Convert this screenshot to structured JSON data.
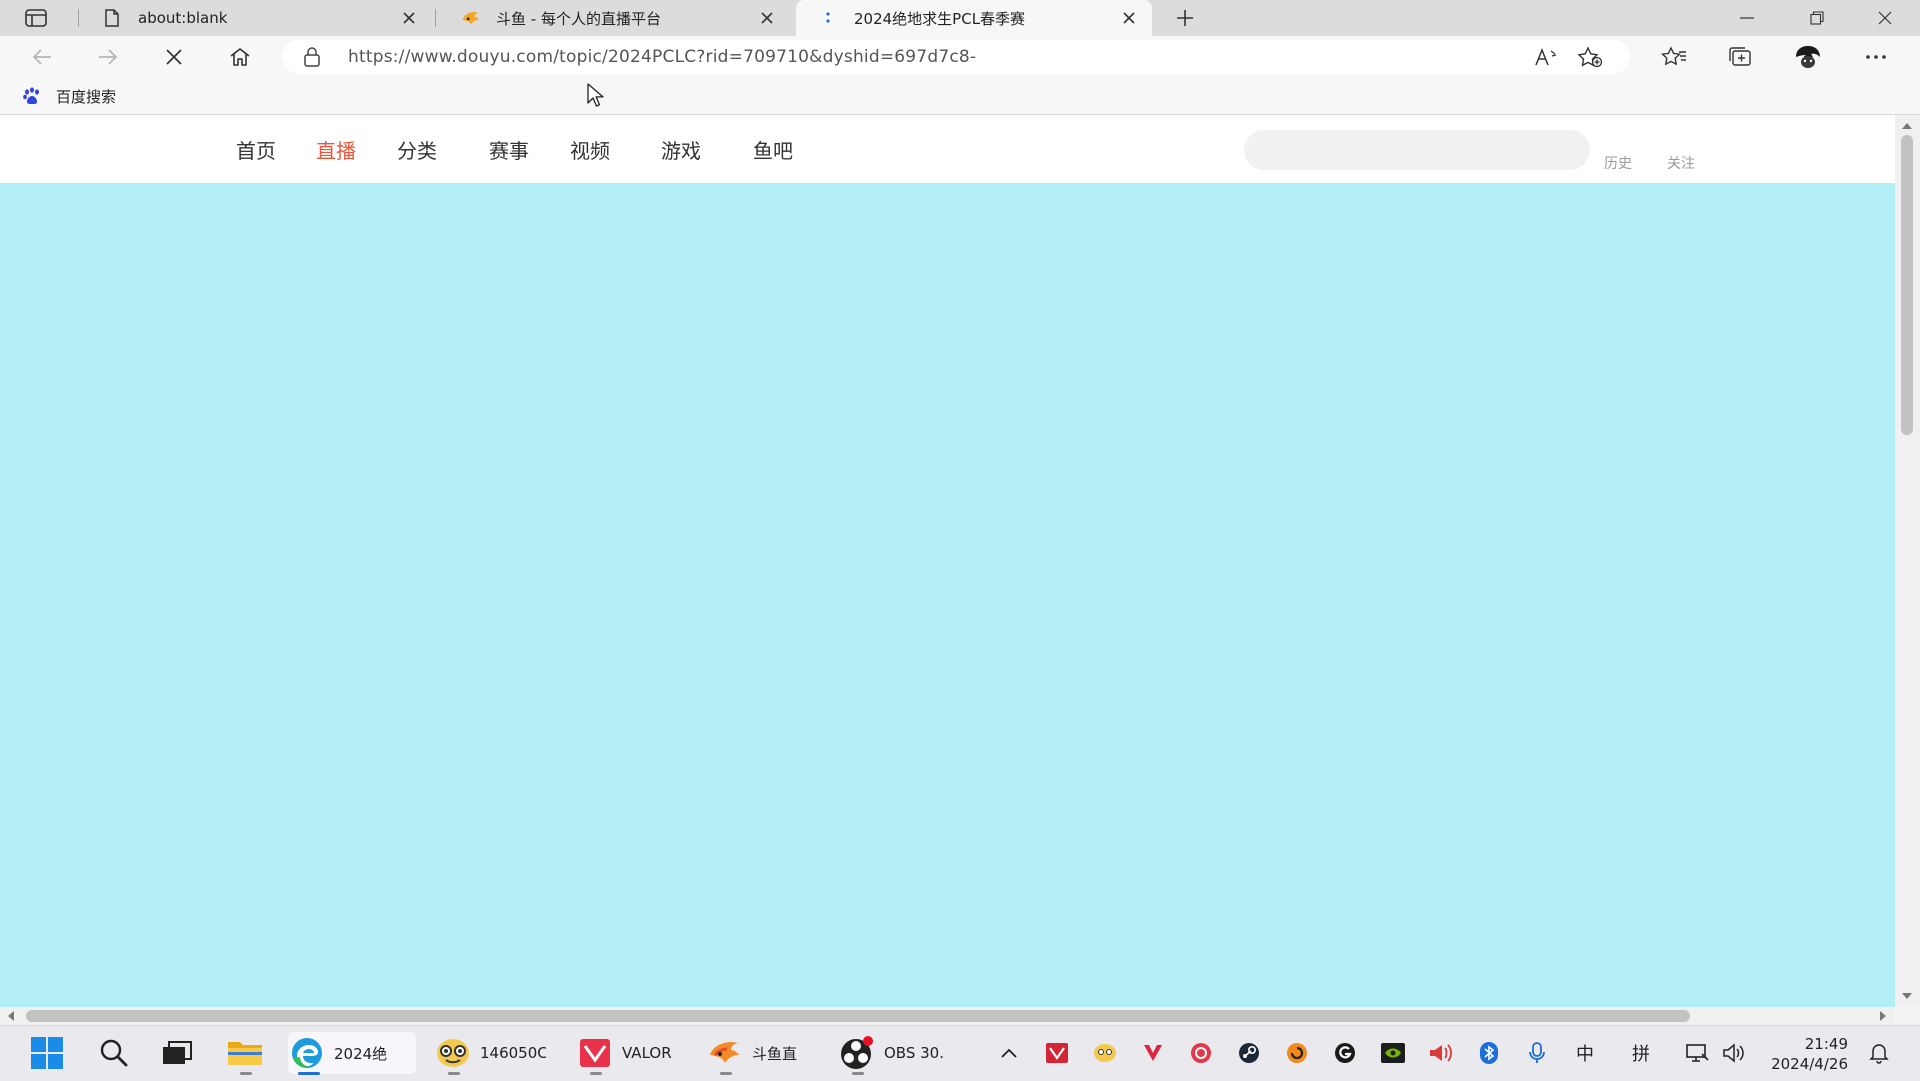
{
  "browser": {
    "tabs": [
      {
        "title": "about:blank",
        "favicon": "page-icon"
      },
      {
        "title": "斗鱼 - 每个人的直播平台",
        "favicon": "douyu-fish-icon"
      },
      {
        "title": "2024绝地求生PCL春季赛",
        "favicon": "loading-icon"
      }
    ],
    "active_tab": 2,
    "address": {
      "url": "https://www.douyu.com/topic/2024PCLC?rid=709710&dyshid=697d7c8-"
    },
    "favorites": [
      {
        "label": "百度搜索",
        "icon": "baidu-paw-icon"
      }
    ]
  },
  "site": {
    "nav": [
      "首页",
      "直播",
      "分类",
      "赛事",
      "视频",
      "游戏",
      "鱼吧"
    ],
    "active_nav": "直播",
    "search": {
      "placeholder": ""
    },
    "history_label": "历史",
    "follow_label": "关注",
    "hero_color": "#b3eef6"
  },
  "taskbar": {
    "apps": [
      {
        "name": "start",
        "label": ""
      },
      {
        "name": "search",
        "label": ""
      },
      {
        "name": "task-view",
        "label": ""
      },
      {
        "name": "file-explorer",
        "label": ""
      },
      {
        "name": "edge",
        "label": "2024绝"
      },
      {
        "name": "app-1460500",
        "label": "146050C"
      },
      {
        "name": "valorant",
        "label": "VALOR"
      },
      {
        "name": "douyu",
        "label": "斗鱼直"
      },
      {
        "name": "obs",
        "label": "OBS 30."
      }
    ],
    "tray": {
      "ime_lang": "中",
      "ime_mode": "拼"
    },
    "clock": {
      "time": "21:49",
      "date": "2024/4/26"
    }
  }
}
